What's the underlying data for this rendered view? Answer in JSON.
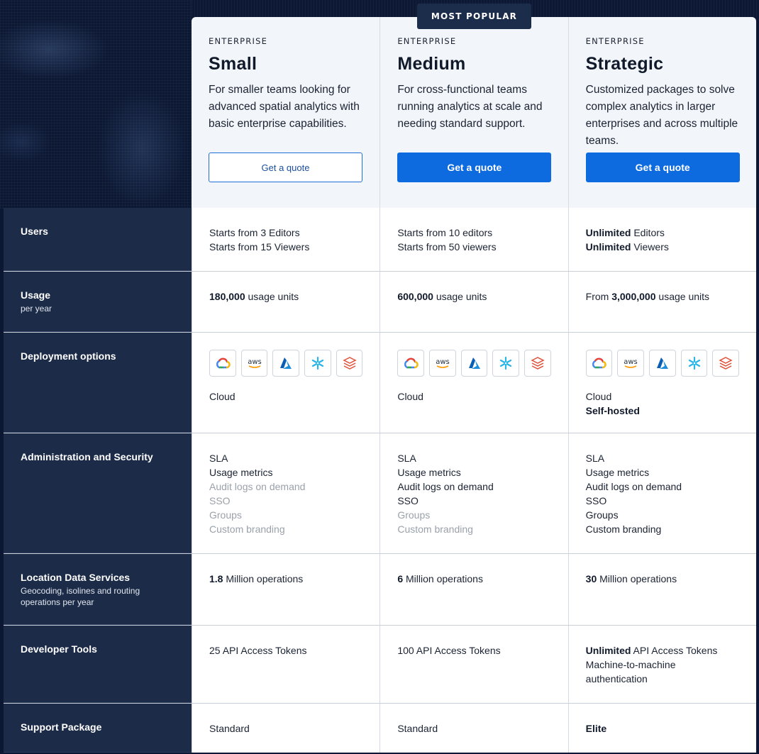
{
  "badge": "MOST POPULAR",
  "plans": [
    {
      "eyebrow": "ENTERPRISE",
      "name": "Small",
      "description": "For smaller teams looking for advanced spatial analytics with basic enterprise capabilities.",
      "cta": "Get a quote"
    },
    {
      "eyebrow": "ENTERPRISE",
      "name": "Medium",
      "description": "For cross-functional teams running analytics at scale and needing standard support.",
      "cta": "Get a quote"
    },
    {
      "eyebrow": "ENTERPRISE",
      "name": "Strategic",
      "description": "Customized packages to solve complex analytics in larger enterprises and across multiple teams.",
      "cta": "Get a quote"
    }
  ],
  "rows": {
    "users": {
      "label": "Users",
      "small": [
        "Starts from 3 Editors",
        "Starts from 15 Viewers"
      ],
      "medium": [
        "Starts from 10 editors",
        "Starts from 50 viewers"
      ],
      "strategic": {
        "bold1": "Unlimited",
        "rest1": " Editors",
        "bold2": "Unlimited",
        "rest2": " Viewers"
      }
    },
    "usage": {
      "label": "Usage",
      "sub": "per year",
      "small": {
        "bold": "180,000",
        "rest": " usage units"
      },
      "medium": {
        "bold": "600,000",
        "rest": " usage units"
      },
      "strategic": {
        "pre": "From ",
        "bold": "3,000,000",
        "rest": " usage units"
      }
    },
    "deployment": {
      "label": "Deployment options",
      "icons": [
        "google-cloud-icon",
        "aws-icon",
        "azure-icon",
        "snowflake-icon",
        "databricks-icon"
      ],
      "aws_text": "aws",
      "small": "Cloud",
      "medium": "Cloud",
      "strategic": [
        "Cloud",
        "Self-hosted"
      ]
    },
    "admin": {
      "label": "Administration and Security",
      "items": [
        "SLA",
        "Usage metrics",
        "Audit logs on demand",
        "SSO",
        "Groups",
        "Custom branding"
      ],
      "small_enabled": [
        true,
        true,
        false,
        false,
        false,
        false
      ],
      "medium_enabled": [
        true,
        true,
        true,
        true,
        false,
        false
      ],
      "strategic_enabled": [
        true,
        true,
        true,
        true,
        true,
        true
      ]
    },
    "lds": {
      "label": "Location Data Services",
      "sub": "Geocoding, isolines and routing operations per year",
      "small": {
        "bold": "1.8",
        "rest": " Million operations"
      },
      "medium": {
        "bold": "6",
        "rest": " Million operations"
      },
      "strategic": {
        "bold": "30",
        "rest": " Million operations"
      }
    },
    "dev": {
      "label": "Developer Tools",
      "small": "25 API Access Tokens",
      "medium": "100 API Access Tokens",
      "strategic": {
        "bold": "Unlimited",
        "rest": " API Access Tokens",
        "line2": "Machine-to-machine authentication"
      }
    },
    "support": {
      "label": "Support Package",
      "small": "Standard",
      "medium": "Standard",
      "strategic": "Elite"
    }
  }
}
